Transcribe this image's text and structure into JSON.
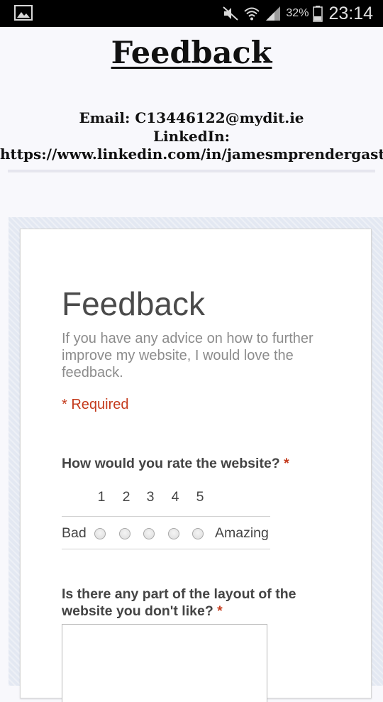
{
  "status_bar": {
    "icons": [
      "gallery-icon",
      "mute-icon",
      "wifi-icon",
      "signal-icon",
      "battery-icon"
    ],
    "battery_percent": "32%",
    "time": "23:14"
  },
  "header": {
    "title": "Feedback",
    "email_line": "Email: C13446122@mydit.ie",
    "linkedin_label": "LinkedIn:",
    "linkedin_url": "https://www.linkedin.com/in/jamesmprendergast"
  },
  "form": {
    "title": "Feedback",
    "description": "If you have any advice on how to further improve my website, I would love the feedback.",
    "required_note": "* Required",
    "questions": [
      {
        "label": "How would you rate the website?",
        "required_mark": "*",
        "type": "linear-scale",
        "scale": [
          "1",
          "2",
          "3",
          "4",
          "5"
        ],
        "low_label": "Bad",
        "high_label": "Amazing"
      },
      {
        "label": "Is there any part of the layout of the website you don't like?",
        "required_mark": "*",
        "type": "paragraph",
        "value": ""
      }
    ]
  },
  "colors": {
    "required_red": "#c43b1d",
    "status_bar": "#000000",
    "form_text": "#444444"
  }
}
